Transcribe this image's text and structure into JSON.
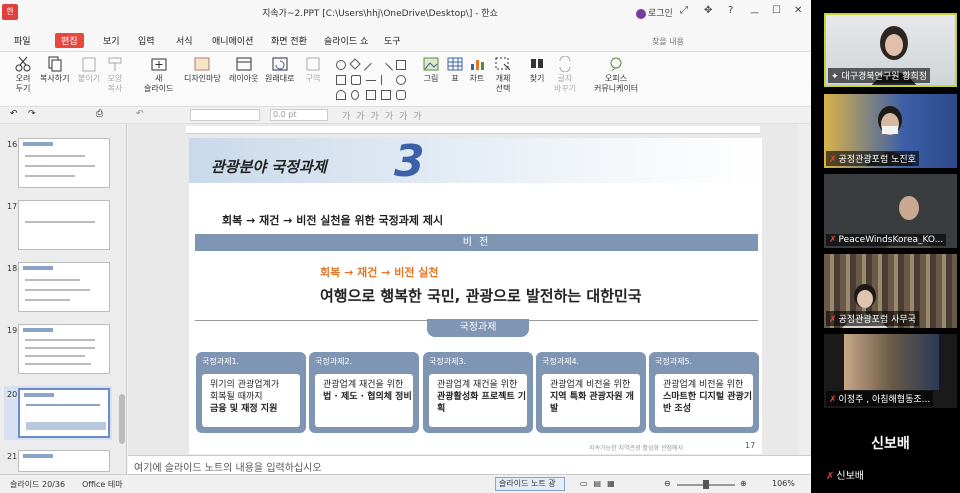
{
  "window": {
    "logo": "한",
    "title": "지속가~2.PPT [C:\\Users\\hhj\\OneDrive\\Desktop\\] - 한쇼",
    "login": "로그인",
    "controls": [
      "?",
      "ㅡ",
      "☐",
      "✕"
    ]
  },
  "menu": {
    "items": [
      "파일",
      "편집",
      "보기",
      "입력",
      "서식",
      "애니메이션",
      "화면 전환",
      "슬라이드 쇼",
      "도구"
    ],
    "search_placeholder": "찾을 내용"
  },
  "ribbon": {
    "buttons": [
      {
        "label": "오려\n두기",
        "icon": "scissors-icon"
      },
      {
        "label": "복사하기",
        "icon": "copy-icon"
      },
      {
        "label": "붙이기",
        "icon": "paste-icon",
        "disabled": true
      },
      {
        "label": "모양\n복사",
        "icon": "format-painter-icon",
        "disabled": true
      },
      {
        "label": "새\n슬라이드",
        "icon": "new-slide-icon"
      },
      {
        "label": "디자인마당",
        "icon": "design-icon"
      },
      {
        "label": "레이아웃",
        "icon": "layout-icon"
      },
      {
        "label": "원래대로",
        "icon": "reset-icon"
      },
      {
        "label": "구역",
        "icon": "section-icon",
        "disabled": true
      },
      {
        "label": "그림",
        "icon": "picture-icon"
      },
      {
        "label": "표",
        "icon": "table-icon"
      },
      {
        "label": "차트",
        "icon": "chart-icon"
      },
      {
        "label": "개체\n선택",
        "icon": "select-icon"
      },
      {
        "label": "찾기",
        "icon": "find-icon"
      },
      {
        "label": "글자\n바꾸기",
        "icon": "replace-icon",
        "disabled": true
      },
      {
        "label": "오피스\n커뮤니케이터",
        "icon": "communicator-icon"
      }
    ]
  },
  "toolbar2": {
    "font_size": "0.0",
    "unit": "pt"
  },
  "thumbnails": [
    {
      "num": "16"
    },
    {
      "num": "17"
    },
    {
      "num": "18"
    },
    {
      "num": "19"
    },
    {
      "num": "20"
    },
    {
      "num": "21"
    }
  ],
  "slide": {
    "title": "관광분야 국정과제",
    "number": "3",
    "subtitle": "회복 → 재건 →  비전 실천을 위한 국정과제 제시",
    "vision_label": "비 전",
    "vision_steps": "회복 → 재건 → 비전 실천",
    "vision_main": "여행으로 행복한 국민, 관광으로 발전하는 대한민국",
    "tasks_label": "국정과제",
    "cards": [
      {
        "head": "국정과제1.",
        "lines": [
          "위기의 관광업계가",
          "회복될 때까지"
        ],
        "bold": "금융 및 재정 지원"
      },
      {
        "head": "국정과제2.",
        "lines": [
          "관광업계 재건을 위한"
        ],
        "bold": "법 · 제도 · 협의체 정비"
      },
      {
        "head": "국정과제3.",
        "lines": [
          "관광업계 재건을 위한"
        ],
        "bold": "관광활성화 프로젝트 기획"
      },
      {
        "head": "국정과제4.",
        "lines": [
          "관광업계 비전을 위한"
        ],
        "bold": "지역 특화 관광자원 개발"
      },
      {
        "head": "국정과제5.",
        "lines": [
          "관광업계 비전을 위한"
        ],
        "bold": "스마트한 디지털 관광기반 조성"
      }
    ],
    "footer": "지속가능한 지역관광 활성화 관점에서",
    "page": "17"
  },
  "notes": {
    "placeholder": "여기에 슬라이드 노트의 내용을 입력하십시오"
  },
  "status": {
    "slide": "슬라이드 20/36",
    "theme": "Office 테마",
    "notes_btn": "슬라이드 노트 광",
    "zoom": "106%"
  },
  "participants": [
    {
      "name": "대구경북연구원 황희정",
      "muted": false,
      "active": true
    },
    {
      "name": "공정관광포럼 노진호",
      "muted": true
    },
    {
      "name": "PeaceWindsKorea_KO...",
      "muted": true
    },
    {
      "name": "공정관광포럼 사무국",
      "muted": true
    },
    {
      "name": "이정주 , 아침해협동조...",
      "muted": true
    }
  ],
  "speaker": {
    "big": "신보배",
    "name": "신보배"
  }
}
